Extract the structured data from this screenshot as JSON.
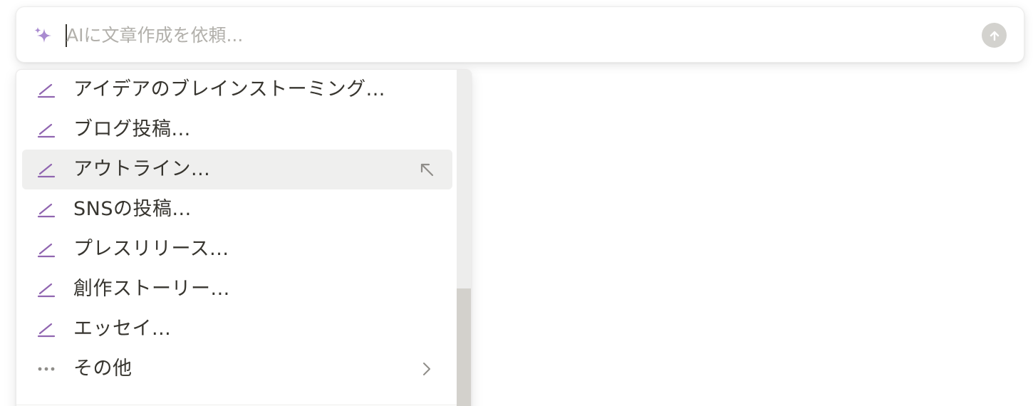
{
  "prompt": {
    "placeholder": "AIに文章作成を依頼...",
    "value": ""
  },
  "icons": {
    "sparkle": "sparkle-icon",
    "send": "arrow-up-circle-icon",
    "pen": "pen-icon",
    "more": "ellipsis-icon",
    "enter": "arrow-up-left-icon",
    "submenu": "chevron-right-icon"
  },
  "colors": {
    "accent_purple": "#9065b0",
    "text": "#37352f",
    "placeholder": "#b2b0ab",
    "hover_bg": "#efefee",
    "send_button": "#d3d2ce"
  },
  "menu": {
    "items": [
      {
        "label": "アイデアのブレインストーミング...",
        "icon": "pen-icon",
        "active": false
      },
      {
        "label": "ブログ投稿...",
        "icon": "pen-icon",
        "active": false
      },
      {
        "label": "アウトライン...",
        "icon": "pen-icon",
        "active": true
      },
      {
        "label": "SNSの投稿...",
        "icon": "pen-icon",
        "active": false
      },
      {
        "label": "プレスリリース...",
        "icon": "pen-icon",
        "active": false
      },
      {
        "label": "創作ストーリー...",
        "icon": "pen-icon",
        "active": false
      },
      {
        "label": "エッセイ...",
        "icon": "pen-icon",
        "active": false
      },
      {
        "label": "その他",
        "icon": "ellipsis-icon",
        "active": false
      }
    ]
  }
}
